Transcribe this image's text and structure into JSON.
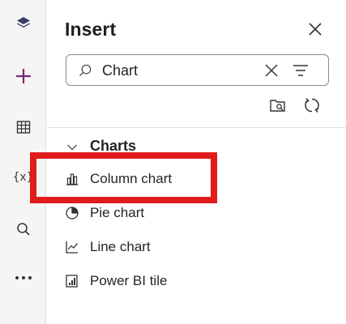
{
  "rail": {
    "items": [
      {
        "icon": "layers-icon"
      },
      {
        "icon": "plus-icon"
      },
      {
        "icon": "table-icon"
      },
      {
        "icon": "variables-icon",
        "text": "{x}"
      },
      {
        "icon": "search-icon"
      },
      {
        "icon": "more-icon",
        "text": "···"
      }
    ]
  },
  "panel": {
    "title": "Insert",
    "search": {
      "value": "Chart"
    },
    "group": {
      "label": "Charts"
    },
    "items": [
      {
        "label": "Column chart",
        "icon": "column-chart-icon"
      },
      {
        "label": "Pie chart",
        "icon": "pie-chart-icon"
      },
      {
        "label": "Line chart",
        "icon": "line-chart-icon"
      },
      {
        "label": "Power BI tile",
        "icon": "power-bi-icon"
      }
    ]
  },
  "colors": {
    "accent": "#742774",
    "highlight": "#e01b1b"
  }
}
